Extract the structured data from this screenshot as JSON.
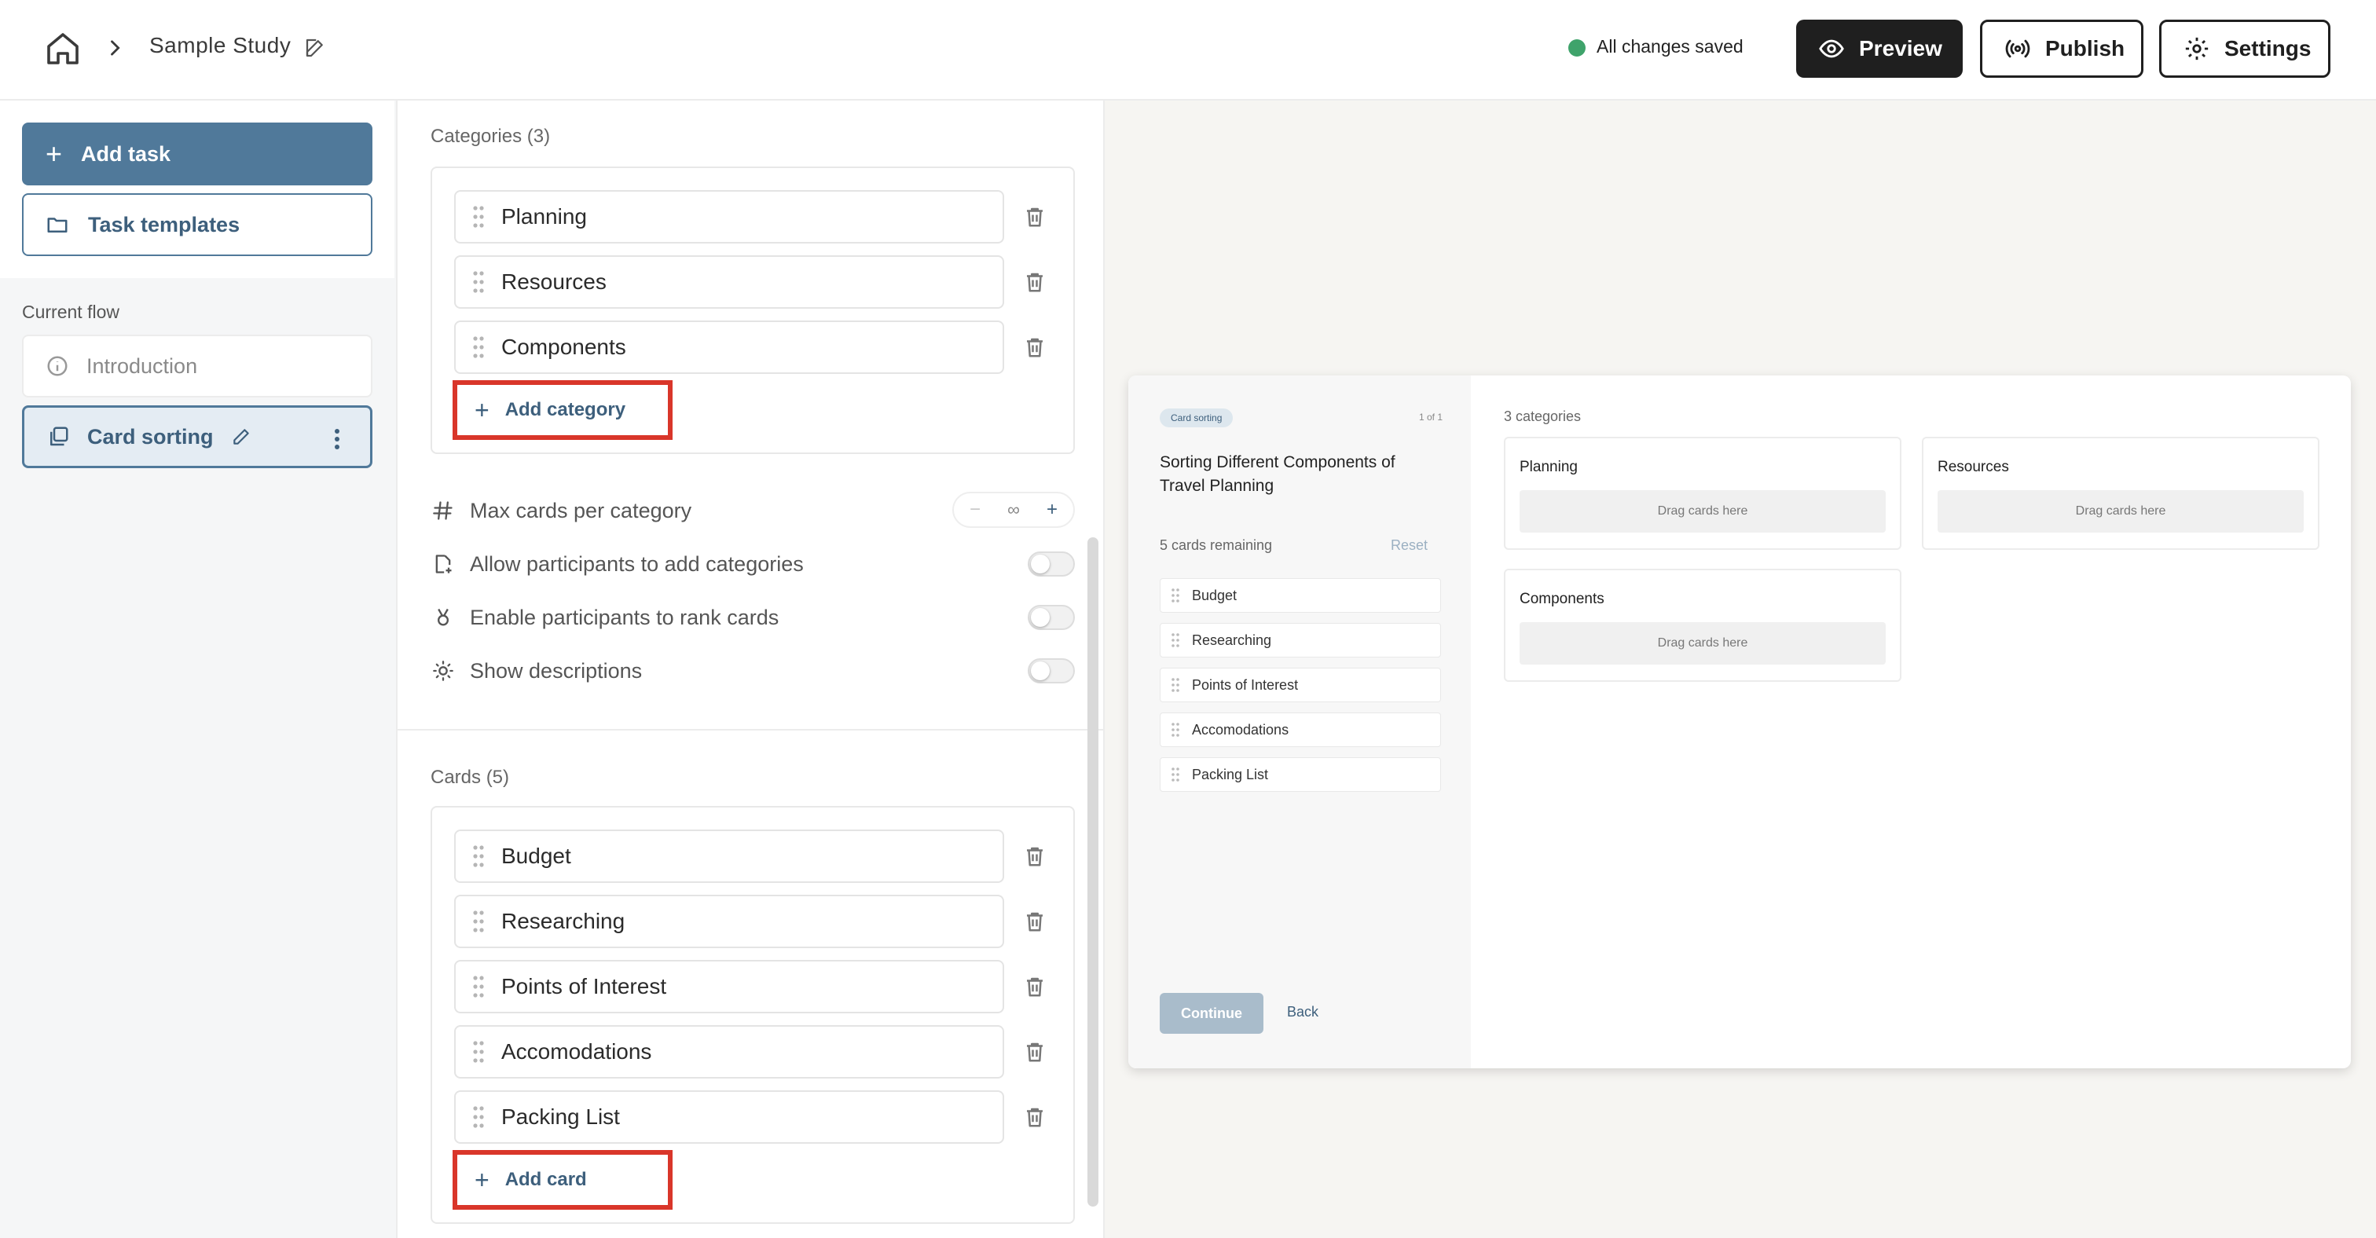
{
  "header": {
    "breadcrumb_title": "Sample Study",
    "save_status": "All changes saved",
    "save_status_color": "#3fa36b",
    "buttons": {
      "preview": "Preview",
      "publish": "Publish",
      "settings": "Settings"
    }
  },
  "sidebar": {
    "add_task": "Add task",
    "task_templates": "Task templates",
    "flow_label": "Current flow",
    "flow": [
      {
        "label": "Introduction",
        "icon": "info-icon"
      },
      {
        "label": "Card sorting",
        "icon": "card-sorting-icon",
        "active": true
      }
    ]
  },
  "editor": {
    "categories_header": "Categories (3)",
    "categories": [
      "Planning",
      "Resources",
      "Components"
    ],
    "add_category": "Add category",
    "options": {
      "max_cards": "Max cards per category",
      "max_cards_value": "∞",
      "allow_add_categories": "Allow participants to add categories",
      "rank_cards": "Enable participants to rank cards",
      "show_descriptions": "Show descriptions"
    },
    "cards_header": "Cards (5)",
    "cards": [
      "Budget",
      "Researching",
      "Points of Interest",
      "Accomodations",
      "Packing List"
    ],
    "add_card": "Add card"
  },
  "preview": {
    "badge": "Card sorting",
    "counter": "1 of 1",
    "title": "Sorting Different Components of Travel Planning",
    "remaining": "5 cards remaining",
    "reset": "Reset",
    "cards": [
      "Budget",
      "Researching",
      "Points of Interest",
      "Accomodations",
      "Packing List"
    ],
    "continue": "Continue",
    "back": "Back",
    "categories_label": "3 categories",
    "categories": [
      {
        "name": "Planning",
        "drop": "Drag cards here"
      },
      {
        "name": "Resources",
        "drop": "Drag cards here"
      },
      {
        "name": "Components",
        "drop": "Drag cards here"
      }
    ]
  },
  "colors": {
    "accent": "#50799a",
    "highlight_box": "#d9362a",
    "dark_button": "#1f1f1f"
  }
}
